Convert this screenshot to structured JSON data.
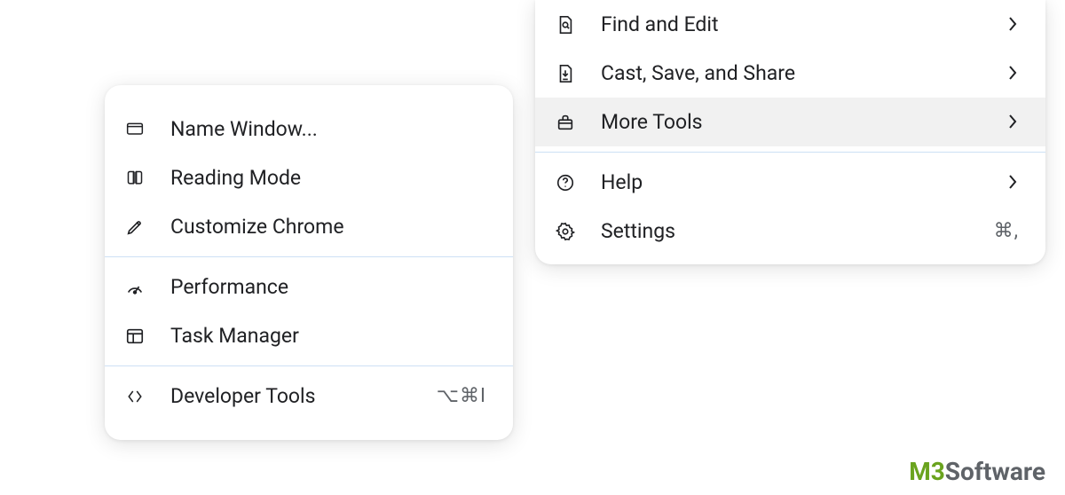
{
  "main_menu": {
    "find_edit": "Find and Edit",
    "cast_save_share": "Cast, Save, and Share",
    "more_tools": "More Tools",
    "help": "Help",
    "settings": "Settings",
    "settings_shortcut": "⌘,"
  },
  "sub_menu": {
    "name_window": "Name Window...",
    "reading_mode": "Reading Mode",
    "customize_chrome": "Customize Chrome",
    "performance": "Performance",
    "task_manager": "Task Manager",
    "developer_tools": "Developer Tools",
    "developer_tools_shortcut": "⌥⌘I"
  },
  "watermark": {
    "m3": "M3",
    "software": "Software"
  }
}
